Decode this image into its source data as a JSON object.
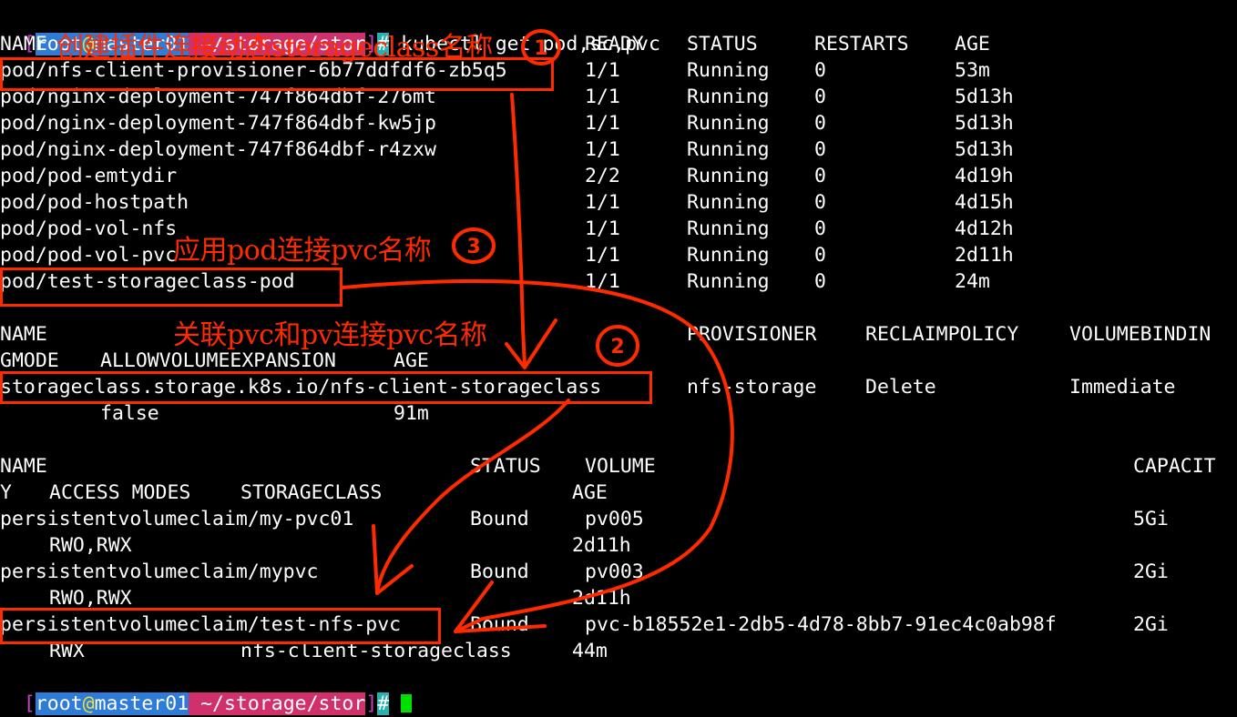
{
  "prompt": {
    "bracket_open": "[",
    "user": "root",
    "at": "@",
    "host": "master01",
    "path": " ~/storage/stor",
    "bracket_close": "]",
    "symbol": "#"
  },
  "command": " kubectl get pod,sc,pvc",
  "pods": {
    "headers": [
      "NAME",
      "READY",
      "STATUS",
      "RESTARTS",
      "AGE"
    ],
    "rows": [
      [
        "pod/nfs-client-provisioner-6b77ddfdf6-zb5q5",
        "1/1",
        "Running",
        "0",
        "53m"
      ],
      [
        "pod/nginx-deployment-747f864dbf-276mt",
        "1/1",
        "Running",
        "0",
        "5d13h"
      ],
      [
        "pod/nginx-deployment-747f864dbf-kw5jp",
        "1/1",
        "Running",
        "0",
        "5d13h"
      ],
      [
        "pod/nginx-deployment-747f864dbf-r4zxw",
        "1/1",
        "Running",
        "0",
        "5d13h"
      ],
      [
        "pod/pod-emtydir",
        "2/2",
        "Running",
        "0",
        "4d19h"
      ],
      [
        "pod/pod-hostpath",
        "1/1",
        "Running",
        "0",
        "4d15h"
      ],
      [
        "pod/pod-vol-nfs",
        "1/1",
        "Running",
        "0",
        "4d12h"
      ],
      [
        "pod/pod-vol-pvc",
        "1/1",
        "Running",
        "0",
        "2d11h"
      ],
      [
        "pod/test-storageclass-pod",
        "1/1",
        "Running",
        "0",
        "24m"
      ]
    ]
  },
  "sc": {
    "header1": [
      "NAME",
      "PROVISIONER",
      "RECLAIMPOLICY",
      "VOLUMEBINDIN"
    ],
    "header2": [
      "GMODE",
      "ALLOWVOLUMEEXPANSION",
      "AGE"
    ],
    "row1": [
      "storageclass.storage.k8s.io/nfs-client-storageclass",
      "nfs-storage",
      "Delete",
      "Immediate"
    ],
    "row2": [
      "false",
      "91m"
    ]
  },
  "pvc": {
    "header1": [
      "NAME",
      "STATUS",
      "VOLUME",
      "CAPACIT"
    ],
    "header2": [
      "Y",
      "ACCESS MODES",
      "STORAGECLASS",
      "AGE"
    ],
    "rows": [
      {
        "name": "persistentvolumeclaim/my-pvc01",
        "status": "Bound",
        "volume": "pv005",
        "capacity": "5Gi",
        "access": "RWO,RWX",
        "sc": "",
        "age": "2d11h"
      },
      {
        "name": "persistentvolumeclaim/mypvc",
        "status": "Bound",
        "volume": "pv003",
        "capacity": "2Gi",
        "access": "RWO,RWX",
        "sc": "",
        "age": "2d11h"
      },
      {
        "name": "persistentvolumeclaim/test-nfs-pvc",
        "status": "Bound",
        "volume": "pvc-b18552e1-2db5-4d78-8bb7-91ec4c0ab98f",
        "capacity": "2Gi",
        "access": "RWX",
        "sc": "nfs-client-storageclass",
        "age": "44m"
      }
    ]
  },
  "annotations": {
    "note1": "创建插件连接动态storageclass名称",
    "note2": "关联pvc和pv连接pvc名称",
    "note3": "应用pod连接pvc名称",
    "num1": "1",
    "num2": "2",
    "num3": "3"
  },
  "colors": {
    "annotation": "#ff2a00",
    "prompt_bg": "#2e7bd8",
    "cursor": "#00e000"
  }
}
